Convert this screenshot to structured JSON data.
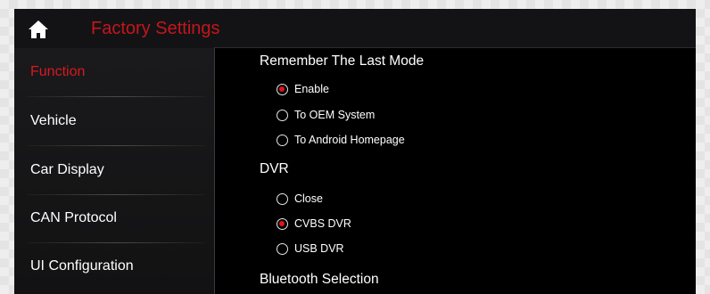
{
  "header": {
    "title": "Factory Settings",
    "home_icon": "home-icon",
    "accent_color": "#d71920"
  },
  "sidebar": {
    "items": [
      {
        "label": "Function",
        "active": true
      },
      {
        "label": "Vehicle",
        "active": false
      },
      {
        "label": "Car Display",
        "active": false
      },
      {
        "label": "CAN Protocol",
        "active": false
      },
      {
        "label": "UI Configuration",
        "active": false
      }
    ]
  },
  "content": {
    "remember_last_mode": {
      "title": "Remember The Last Mode",
      "options": [
        {
          "label": "Enable",
          "selected": true
        },
        {
          "label": "To OEM System",
          "selected": false
        },
        {
          "label": "To Android Homepage",
          "selected": false
        }
      ]
    },
    "dvr": {
      "title": "DVR",
      "options": [
        {
          "label": "Close",
          "selected": false
        },
        {
          "label": "CVBS DVR",
          "selected": true
        },
        {
          "label": "USB DVR",
          "selected": false
        }
      ]
    },
    "bluetooth": {
      "title": "Bluetooth Selection"
    }
  }
}
